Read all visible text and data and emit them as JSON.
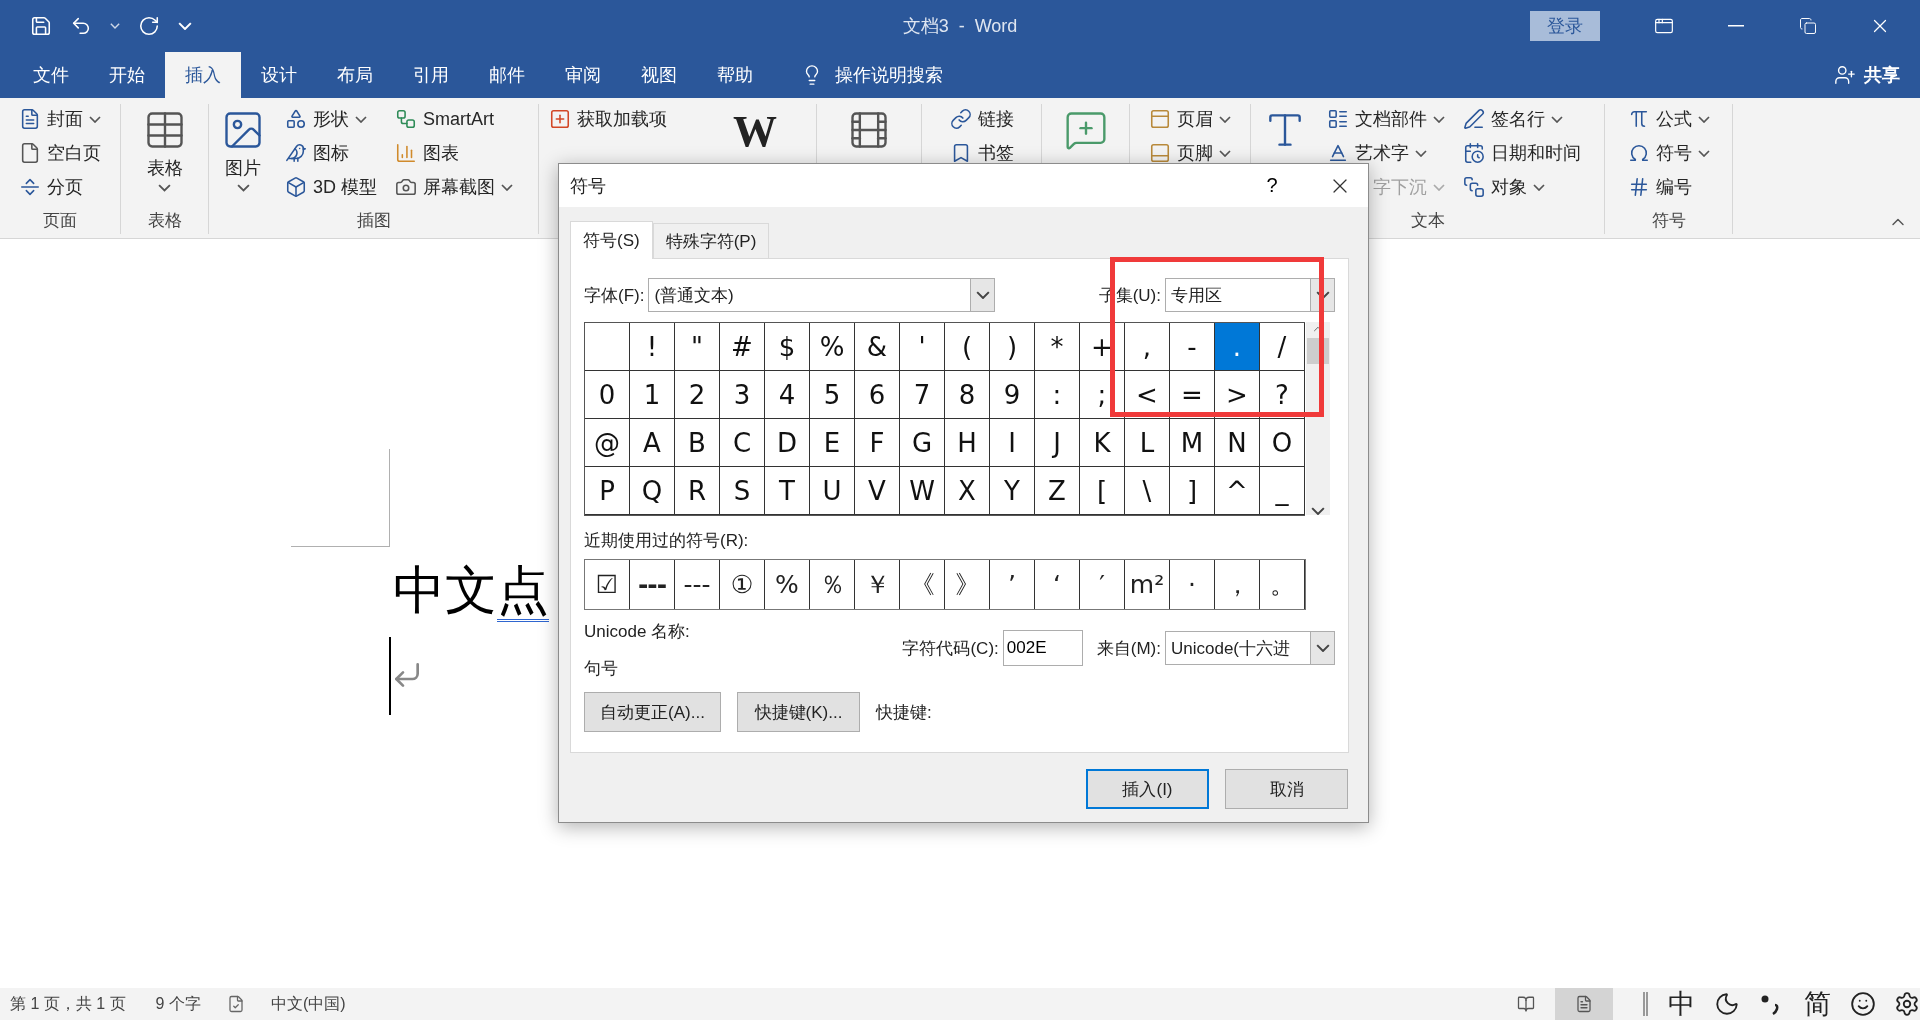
{
  "title_bar": {
    "title": "文档3  -  Word",
    "sign_in": "登录"
  },
  "menu_tabs": [
    {
      "label": "文件",
      "selected": false
    },
    {
      "label": "开始",
      "selected": false
    },
    {
      "label": "插入",
      "selected": true
    },
    {
      "label": "设计",
      "selected": false
    },
    {
      "label": "布局",
      "selected": false
    },
    {
      "label": "引用",
      "selected": false
    },
    {
      "label": "邮件",
      "selected": false
    },
    {
      "label": "审阅",
      "selected": false
    },
    {
      "label": "视图",
      "selected": false
    },
    {
      "label": "帮助",
      "selected": false
    }
  ],
  "tell_me": "操作说明搜索",
  "share": "共享",
  "ribbon_groups": [
    {
      "label": "页面",
      "columns": [
        {
          "kind": "stack",
          "items": [
            {
              "label": "封面",
              "dropdown": true,
              "disabled": false
            },
            {
              "label": "空白页",
              "dropdown": false,
              "disabled": false
            },
            {
              "label": "分页",
              "dropdown": false,
              "disabled": false
            }
          ]
        }
      ]
    },
    {
      "label": "表格",
      "columns": [
        {
          "kind": "large",
          "label": "表格",
          "dropdown": true
        }
      ]
    },
    {
      "label": "插图",
      "columns": [
        {
          "kind": "large",
          "label": "图片",
          "dropdown": true
        },
        {
          "kind": "stack",
          "items": [
            {
              "label": "形状",
              "dropdown": true,
              "disabled": false
            },
            {
              "label": "图标",
              "dropdown": false,
              "disabled": false
            },
            {
              "label": "3D 模型",
              "dropdown": false,
              "disabled": false
            }
          ]
        },
        {
          "kind": "stack",
          "items": [
            {
              "label": "SmartArt",
              "dropdown": false,
              "disabled": false
            },
            {
              "label": "图表",
              "dropdown": false,
              "disabled": false
            },
            {
              "label": "屏幕截图",
              "dropdown": true,
              "disabled": false
            }
          ]
        }
      ]
    },
    {
      "columns": [
        {
          "kind": "stack",
          "items": [
            {
              "label": "获取加载项",
              "dropdown": false,
              "disabled": false
            }
          ]
        },
        {
          "kind": "large",
          "glyph": "W",
          "dropdown": false
        }
      ]
    },
    {
      "columns": [
        {
          "kind": "large",
          "dropdown": false
        }
      ]
    },
    {
      "columns": [
        {
          "kind": "stack",
          "items": [
            {
              "label": "链接",
              "dropdown": false,
              "disabled": false
            },
            {
              "label": "书签",
              "dropdown": false,
              "disabled": false
            }
          ]
        }
      ]
    },
    {
      "columns": [
        {
          "kind": "large",
          "dropdown": false
        }
      ]
    },
    {
      "columns": [
        {
          "kind": "stack",
          "items": [
            {
              "label": "页眉",
              "dropdown": true,
              "disabled": false
            },
            {
              "label": "页脚",
              "dropdown": true,
              "disabled": false
            }
          ]
        }
      ]
    },
    {
      "label": "文本",
      "columns": [
        {
          "kind": "large",
          "dropdown": false
        },
        {
          "kind": "stack",
          "items": [
            {
              "label": "文档部件",
              "dropdown": true,
              "disabled": false
            },
            {
              "label": "艺术字",
              "dropdown": true,
              "disabled": false
            },
            {
              "label": "字下沉",
              "dropdown": true,
              "disabled": true
            }
          ]
        },
        {
          "kind": "stack",
          "items": [
            {
              "label": "签名行",
              "dropdown": true,
              "disabled": false
            },
            {
              "label": "日期和时间",
              "dropdown": false,
              "disabled": false
            },
            {
              "label": "对象",
              "dropdown": true,
              "disabled": false
            }
          ]
        }
      ]
    },
    {
      "label": "符号",
      "columns": [
        {
          "kind": "stack",
          "items": [
            {
              "label": "公式",
              "dropdown": true,
              "disabled": false
            },
            {
              "label": "符号",
              "dropdown": true,
              "disabled": false
            },
            {
              "label": "编号",
              "dropdown": false,
              "disabled": false
            }
          ]
        }
      ]
    }
  ],
  "document": {
    "text": "中文",
    "flagged_text": "点"
  },
  "dialog": {
    "title": "符号",
    "help": "?",
    "tabs": [
      {
        "label": "符号(S)",
        "selected": true
      },
      {
        "label": "特殊字符(P)",
        "selected": false
      }
    ],
    "font_label": "字体(F):",
    "font_value": "(普通文本)",
    "subset_label": "子集(U):",
    "subset_value": "专用区",
    "symbols": [
      {
        "selected": false
      },
      {
        "char": "!",
        "selected": false
      },
      {
        "char": "\"",
        "selected": false
      },
      {
        "char": "#",
        "selected": false
      },
      {
        "char": "$",
        "selected": false
      },
      {
        "char": "%",
        "selected": false
      },
      {
        "char": "&",
        "selected": false
      },
      {
        "char": "'",
        "selected": false
      },
      {
        "char": "(",
        "selected": false
      },
      {
        "char": ")",
        "selected": false
      },
      {
        "char": "*",
        "selected": false
      },
      {
        "char": "+",
        "selected": false
      },
      {
        "char": ",",
        "selected": false
      },
      {
        "char": "-",
        "selected": false
      },
      {
        "char": ".",
        "selected": true
      },
      {
        "char": "/",
        "selected": false
      },
      {
        "char": "0",
        "selected": false
      },
      {
        "char": "1",
        "selected": false
      },
      {
        "char": "2",
        "selected": false
      },
      {
        "char": "3",
        "selected": false
      },
      {
        "char": "4",
        "selected": false
      },
      {
        "char": "5",
        "selected": false
      },
      {
        "char": "6",
        "selected": false
      },
      {
        "char": "7",
        "selected": false
      },
      {
        "char": "8",
        "selected": false
      },
      {
        "char": "9",
        "selected": false
      },
      {
        "char": ":",
        "selected": false
      },
      {
        "char": ";",
        "selected": false
      },
      {
        "char": "<",
        "selected": false
      },
      {
        "char": "=",
        "selected": false
      },
      {
        "char": ">",
        "selected": false
      },
      {
        "char": "?",
        "selected": false
      },
      {
        "char": "@",
        "selected": false
      },
      {
        "char": "A",
        "selected": false
      },
      {
        "char": "B",
        "selected": false
      },
      {
        "char": "C",
        "selected": false
      },
      {
        "char": "D",
        "selected": false
      },
      {
        "char": "E",
        "selected": false
      },
      {
        "char": "F",
        "selected": false
      },
      {
        "char": "G",
        "selected": false
      },
      {
        "char": "H",
        "selected": false
      },
      {
        "char": "I",
        "selected": false
      },
      {
        "char": "J",
        "selected": false
      },
      {
        "char": "K",
        "selected": false
      },
      {
        "char": "L",
        "selected": false
      },
      {
        "char": "M",
        "selected": false
      },
      {
        "char": "N",
        "selected": false
      },
      {
        "char": "O",
        "selected": false
      },
      {
        "char": "P",
        "selected": false
      },
      {
        "char": "Q",
        "selected": false
      },
      {
        "char": "R",
        "selected": false
      },
      {
        "char": "S",
        "selected": false
      },
      {
        "char": "T",
        "selected": false
      },
      {
        "char": "U",
        "selected": false
      },
      {
        "char": "V",
        "selected": false
      },
      {
        "char": "W",
        "selected": false
      },
      {
        "char": "X",
        "selected": false
      },
      {
        "char": "Y",
        "selected": false
      },
      {
        "char": "Z",
        "selected": false
      },
      {
        "char": "[",
        "selected": false
      },
      {
        "char": "\\",
        "selected": false
      },
      {
        "char": "]",
        "selected": false
      },
      {
        "char": "^",
        "selected": false
      },
      {
        "char": "_",
        "selected": false
      }
    ],
    "recent_label": "近期使用过的符号(R):",
    "recent": [
      {
        "char": "☑",
        "bold": false
      },
      {
        "char": "---",
        "bold": true
      },
      {
        "char": "---",
        "bold": false
      },
      {
        "char": "①",
        "bold": false
      },
      {
        "char": "%",
        "bold": false
      },
      {
        "char": "％",
        "bold": false
      },
      {
        "char": "￥",
        "bold": false
      },
      {
        "char": "《",
        "bold": false
      },
      {
        "char": "》",
        "bold": false
      },
      {
        "char": "’",
        "bold": false
      },
      {
        "char": "‘",
        "bold": false
      },
      {
        "char": "′",
        "bold": false
      },
      {
        "char": "m²",
        "bold": false
      },
      {
        "char": "·",
        "bold": false
      },
      {
        "char": "，",
        "bold": false
      },
      {
        "char": "。",
        "bold": false
      }
    ],
    "unicode_name_label": "Unicode 名称:",
    "unicode_name": "句号",
    "code_label": "字符代码(C):",
    "code_value": "002E",
    "from_label": "来自(M):",
    "from_value": "Unicode(十六进",
    "autocorrect_button": "自动更正(A)...",
    "shortcut_button": "快捷键(K)...",
    "shortcut_label": "快捷键:",
    "insert_button": "插入(I)",
    "cancel_button": "取消"
  },
  "status": {
    "page": "第 1 页，共 1 页",
    "words": "9 个字",
    "language": "中文(中国)"
  },
  "views": [
    {
      "kind": "read",
      "selected": false
    },
    {
      "kind": "print",
      "selected": true
    }
  ],
  "ime": {
    "mode": "中",
    "script": "简"
  }
}
